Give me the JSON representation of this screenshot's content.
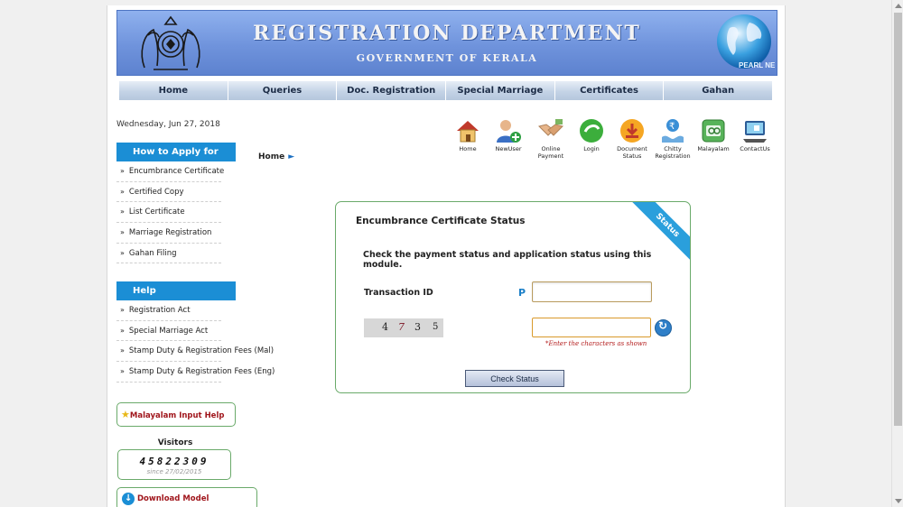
{
  "header": {
    "title": "REGISTRATION DEPARTMENT",
    "subtitle": "GOVERNMENT OF KERALA",
    "globe_label": "PEARL NET"
  },
  "nav": [
    {
      "label": "Home"
    },
    {
      "label": "Queries"
    },
    {
      "label": "Doc. Registration"
    },
    {
      "label": "Special Marriage"
    },
    {
      "label": "Certificates"
    },
    {
      "label": "Gahan"
    }
  ],
  "date": "Wednesday, Jun 27, 2018",
  "toolbar": [
    {
      "label": "Home",
      "icon": "house-icon"
    },
    {
      "label": "NewUser",
      "icon": "new-user-icon"
    },
    {
      "label": "Online Payment",
      "icon": "handshake-icon"
    },
    {
      "label": "Login",
      "icon": "login-icon"
    },
    {
      "label": "Document Status",
      "icon": "download-icon"
    },
    {
      "label": "Chitty Registration",
      "icon": "rupee-hand-icon"
    },
    {
      "label": "Malayalam",
      "icon": "malayalam-icon"
    },
    {
      "label": "ContactUs",
      "icon": "contact-icon"
    }
  ],
  "how_to_apply": {
    "heading": "How to Apply for",
    "items": [
      {
        "label": "Encumbrance Certificate"
      },
      {
        "label": "Certified Copy"
      },
      {
        "label": "List Certificate"
      },
      {
        "label": "Marriage Registration"
      },
      {
        "label": "Gahan Filing"
      }
    ]
  },
  "help": {
    "heading": "Help",
    "items": [
      {
        "label": "Registration Act"
      },
      {
        "label": "Special Marriage Act"
      },
      {
        "label": "Stamp Duty & Registration Fees (Mal)"
      },
      {
        "label": "Stamp Duty & Registration Fees (Eng)"
      }
    ]
  },
  "malayalam_help": "Malayalam Input Help",
  "visitors": {
    "label": "Visitors",
    "count": "45822309",
    "since": "since 27/02/2015"
  },
  "download": "Download Model Documents",
  "breadcrumb": "Home",
  "panel": {
    "title": "Encumbrance Certificate Status",
    "ribbon": "Status",
    "description": "Check the payment status and application status using this module.",
    "transaction_label": "Transaction ID",
    "transaction_prefix": "P",
    "transaction_value": "",
    "captcha": [
      "4",
      "7",
      "3",
      "5"
    ],
    "captcha_value": "",
    "captcha_hint": "*Enter the characters as shown",
    "submit": "Check Status"
  },
  "colors": {
    "banner": "#6f93dc",
    "section_heading": "#1b8ed5",
    "panel_border": "#6aaa6a",
    "link_red": "#a0161c"
  }
}
